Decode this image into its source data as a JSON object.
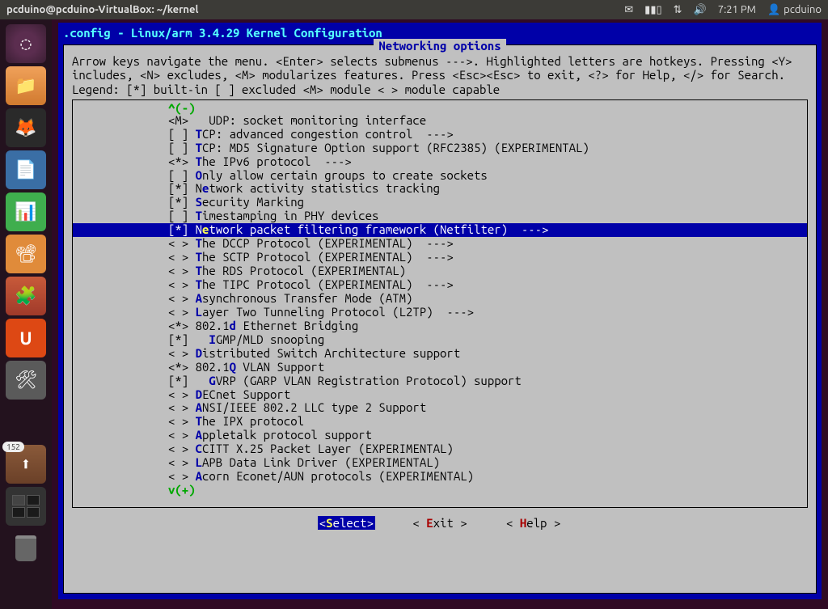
{
  "panel": {
    "title": "pcduino@pcduino-VirtualBox: ~/kernel",
    "mail_icon": "✉",
    "battery_icon": "▮▮▯",
    "network_icon": "⇅",
    "sound_icon": "🔊",
    "time": "7:21 PM",
    "user_icon": "👤",
    "user": "pcduino"
  },
  "launcher": {
    "dash": "◌",
    "files": "📁",
    "firefox": "🦊",
    "writer": "📄",
    "calc": "📊",
    "impress": "📽",
    "software": "🧩",
    "usc": "U",
    "settings": "🛠",
    "updates_badge": "152",
    "updates": "⬆"
  },
  "menuconfig": {
    "title": ".config - Linux/arm 3.4.29 Kernel Configuration",
    "section": "Networking options",
    "help_lines": "Arrow keys navigate the menu.  <Enter> selects submenus --->.  Highlighted letters are hotkeys.  Pressing <Y> includes, <N> excludes, <M> modularizes features.  Press <Esc><Esc> to exit, <?> for Help, </> for Search.  Legend: [*] built-in  [ ] excluded  <M> module  < > module capable",
    "scroll_top": "^(-)",
    "scroll_bot": "v(+)",
    "items": [
      {
        "mark": "<M>",
        "indent": "   ",
        "hk": "",
        "text": "UDP: socket monitoring interface"
      },
      {
        "mark": "[ ]",
        "indent": " ",
        "hk": "T",
        "text": "CP: advanced congestion control  --->"
      },
      {
        "mark": "[ ]",
        "indent": " ",
        "hk": "T",
        "text": "CP: MD5 Signature Option support (RFC2385) (EXPERIMENTAL)"
      },
      {
        "mark": "<*>",
        "indent": " ",
        "hk": "T",
        "text": "he IPv6 protocol  --->"
      },
      {
        "mark": "[ ]",
        "indent": " ",
        "hk": "O",
        "text": "nly allow certain groups to create sockets"
      },
      {
        "mark": "[*]",
        "indent": " N",
        "hk": "e",
        "text": "twork activity statistics tracking"
      },
      {
        "mark": "[*]",
        "indent": " ",
        "hk": "S",
        "text": "ecurity Marking"
      },
      {
        "mark": "[ ]",
        "indent": " ",
        "hk": "T",
        "text": "imestamping in PHY devices"
      },
      {
        "mark": "[*]",
        "indent": " N",
        "hk": "e",
        "text": "twork packet filtering framework (Netfilter)  --->",
        "selected": true
      },
      {
        "mark": "< >",
        "indent": " ",
        "hk": "T",
        "text": "he DCCP Protocol (EXPERIMENTAL)  --->"
      },
      {
        "mark": "< >",
        "indent": " ",
        "hk": "T",
        "text": "he SCTP Protocol (EXPERIMENTAL)  --->"
      },
      {
        "mark": "< >",
        "indent": " ",
        "hk": "T",
        "text": "he RDS Protocol (EXPERIMENTAL)"
      },
      {
        "mark": "< >",
        "indent": " ",
        "hk": "T",
        "text": "he TIPC Protocol (EXPERIMENTAL)  --->"
      },
      {
        "mark": "< >",
        "indent": " ",
        "hk": "A",
        "text": "synchronous Transfer Mode (ATM)"
      },
      {
        "mark": "< >",
        "indent": " ",
        "hk": "L",
        "text": "ayer Two Tunneling Protocol (L2TP)  --->"
      },
      {
        "mark": "<*>",
        "indent": " 802.1",
        "hk": "d",
        "text": " Ethernet Bridging"
      },
      {
        "mark": "[*]",
        "indent": "   ",
        "hk": "I",
        "text": "GMP/MLD snooping"
      },
      {
        "mark": "< >",
        "indent": " ",
        "hk": "D",
        "text": "istributed Switch Architecture support"
      },
      {
        "mark": "<*>",
        "indent": " 802.1",
        "hk": "Q",
        "text": " VLAN Support"
      },
      {
        "mark": "[*]",
        "indent": "   ",
        "hk": "G",
        "text": "VRP (GARP VLAN Registration Protocol) support"
      },
      {
        "mark": "< >",
        "indent": " ",
        "hk": "D",
        "text": "ECnet Support"
      },
      {
        "mark": "< >",
        "indent": " ",
        "hk": "A",
        "text": "NSI/IEEE 802.2 LLC type 2 Support"
      },
      {
        "mark": "< >",
        "indent": " ",
        "hk": "T",
        "text": "he IPX protocol"
      },
      {
        "mark": "< >",
        "indent": " ",
        "hk": "A",
        "text": "ppletalk protocol support"
      },
      {
        "mark": "< >",
        "indent": " ",
        "hk": "C",
        "text": "CITT X.25 Packet Layer (EXPERIMENTAL)"
      },
      {
        "mark": "< >",
        "indent": " ",
        "hk": "L",
        "text": "APB Data Link Driver (EXPERIMENTAL)"
      },
      {
        "mark": "< >",
        "indent": " ",
        "hk": "A",
        "text": "corn Econet/AUN protocols (EXPERIMENTAL)"
      }
    ],
    "buttons": {
      "select": {
        "pre": "<",
        "hk": "S",
        "rest": "elect>"
      },
      "exit": {
        "pre": "< ",
        "hk": "E",
        "rest": "xit >"
      },
      "help": {
        "pre": "< ",
        "hk": "H",
        "rest": "elp >"
      }
    }
  }
}
